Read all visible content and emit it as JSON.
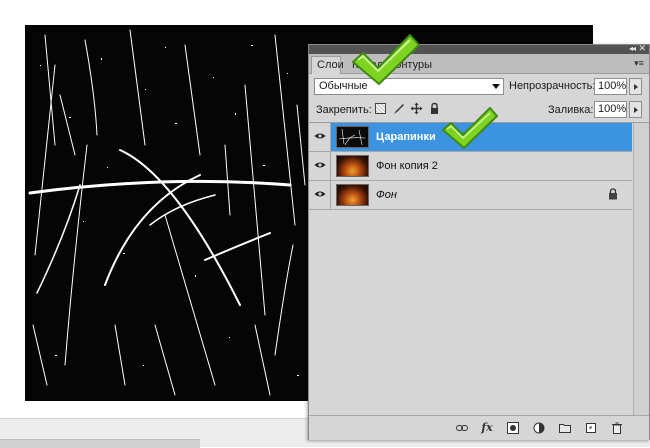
{
  "panel": {
    "tabs": [
      "Слои",
      "Каналы",
      "Контуры"
    ],
    "collapse_glyph": "◂◂",
    "close_glyph": "✕",
    "menu_glyph": "▾≡"
  },
  "blend": {
    "mode": "Обычные",
    "opacity_label": "Непрозрачность:",
    "opacity_value": "100%"
  },
  "lock": {
    "label": "Закрепить:",
    "icons": [
      "lock-transparent-icon",
      "brush-icon",
      "move-icon",
      "padlock-icon"
    ]
  },
  "fill": {
    "label": "Заливка:",
    "value": "100%"
  },
  "layers": [
    {
      "name": "Царапинки",
      "selected": true,
      "thumbnail": "scratches",
      "locked": false
    },
    {
      "name": "Фон копия 2",
      "selected": false,
      "thumbnail": "fire",
      "locked": false
    },
    {
      "name": "Фон",
      "selected": false,
      "thumbnail": "fire",
      "locked": true
    }
  ],
  "bottom_icons": [
    "link-icon",
    "fx-icon",
    "mask-icon",
    "adjustment-icon",
    "folder-icon",
    "new-layer-icon",
    "trash-icon"
  ],
  "colors": {
    "selected_row": "#3c93e0",
    "panel_bg": "#d6d6d6",
    "checkmark": "#7ed321"
  }
}
